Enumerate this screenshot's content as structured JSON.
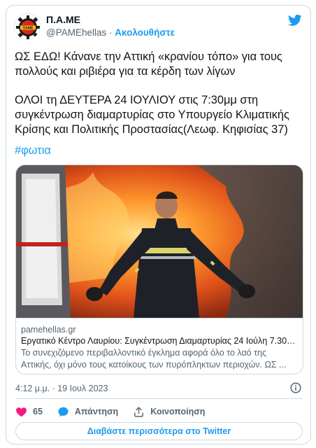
{
  "author": {
    "display_name": "Π.Α.ΜΕ",
    "handle": "@PAMEhellas",
    "separator": "·",
    "follow_label": "Ακολουθήστε",
    "avatar_icon": "pame-logo-icon",
    "logo_text": "ΠΑΜΕ"
  },
  "tweet": {
    "paragraph_1": "ΩΣ ΕΔΩ! Κάνανε την Αττική «κρανίου τόπο» για τους πολλούς και ριβιέρα για τα κέρδη των λίγων",
    "paragraph_2": "ΟΛΟΙ τη ΔΕΥΤΕΡΑ 24 ΙΟΥΛΙΟΥ στις 7:30μμ στη συγκέντρωση διαμαρτυρίας στο Υπουργείο Κλιματικής Κρίσης και Πολιτικής Προστασίας(Λεωφ. Κηφισίας 37)",
    "hashtag": "#φωτια"
  },
  "link_card": {
    "domain": "pamehellas.gr",
    "title": "Εργατικό Κέντρο Λαυρίου: Συγκέντρωση Διαμαρτυρίας 24 Ιούλη 7.30μ...",
    "description": "Το συνεχιζόμενο περιβαλλοντικό έγκλημα αφορά όλο το λαό της Αττικής, όχι μόνο τους κατοίκους των πυρόπληκτων περιοχών. ΩΣ ...",
    "image_icon": "firefighter-wildfire-photo"
  },
  "meta": {
    "timestamp": "4:12 μ.μ. · 19 Ιουλ 2023",
    "info_icon": "info-icon"
  },
  "actions": {
    "like_count": "65",
    "reply_label": "Απάντηση",
    "share_label": "Κοινοποίηση"
  },
  "read_more_label": "Διαβάστε περισσότερα στο Twitter",
  "colors": {
    "accent": "#1d9bf0",
    "like": "#f91880",
    "secondary_text": "#536471",
    "border": "#cfd9de"
  }
}
